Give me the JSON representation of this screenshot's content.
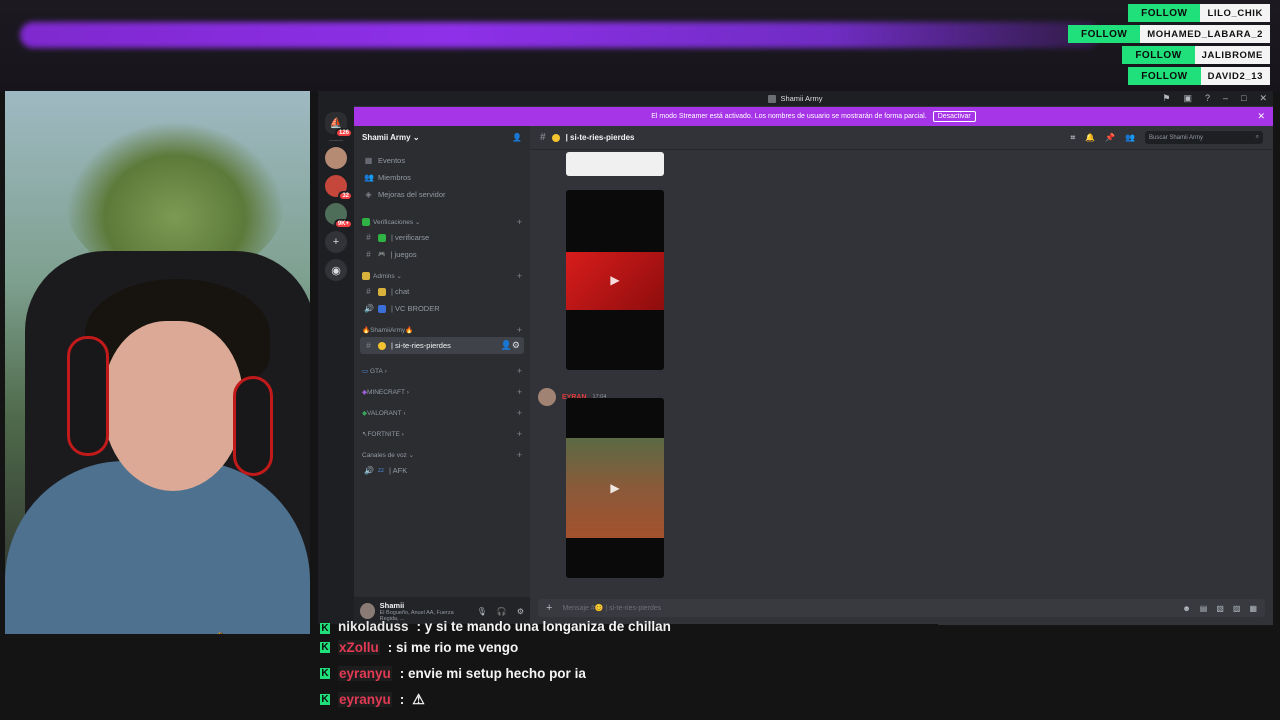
{
  "follows": [
    {
      "btn": "FOLLOW",
      "name": "LILO_CHIK"
    },
    {
      "btn": "FOLLOW",
      "name": "MOHAMED_LABARA_2"
    },
    {
      "btn": "FOLLOW",
      "name": "JALIBROME"
    },
    {
      "btn": "FOLLOW",
      "name": "DAVID2_13"
    }
  ],
  "discord": {
    "window_title": "Shamii Army",
    "streamer_notice": "El modo Streamer está activado. Los nombres de usuario se mostrarán de forma parcial.",
    "streamer_button": "Desactivar",
    "guild_badges": [
      "126",
      "32",
      "9K+"
    ],
    "server_name": "Shamii Army",
    "server_items": [
      {
        "icon": "calendar-icon",
        "label": "Eventos"
      },
      {
        "icon": "members-icon",
        "label": "Miembros"
      },
      {
        "icon": "boost-icon",
        "label": "Mejoras del servidor"
      }
    ],
    "categories": [
      {
        "label": "Verificaciones",
        "channels": [
          {
            "icon": "#",
            "label": "verificarse"
          },
          {
            "icon": "#",
            "label": "juegos"
          }
        ]
      },
      {
        "label": "Admins",
        "channels": [
          {
            "icon": "#",
            "label": "chat"
          },
          {
            "icon": "🔊",
            "label": "VC BRODER"
          }
        ]
      },
      {
        "label": "ShamiiArmy",
        "channels": [
          {
            "icon": "#",
            "label": "si-te-ries-pierdes",
            "active": true
          }
        ]
      },
      {
        "label": "GTA",
        "channels": []
      },
      {
        "label": "MINECRAFT",
        "channels": []
      },
      {
        "label": "VALORANT",
        "channels": []
      },
      {
        "label": "FORTNITE",
        "channels": []
      },
      {
        "label": "Canales de voz",
        "channels": [
          {
            "icon": "🔊",
            "label": "AFK"
          }
        ]
      }
    ],
    "user": {
      "name": "Shamii",
      "status": "El Bogueño, Anuel AA, Fuerza Regida, ..."
    },
    "channel_name": "si-te-ries-pierdes",
    "search_placeholder": "Buscar Shamii Army",
    "message": {
      "author": "EYRAN",
      "time": "17:04"
    },
    "composer_placeholder": "Mensaje #😊 | si-te-ries-pierdes"
  },
  "chat": [
    {
      "user": "nikoladuss",
      "user_color": "#e8e8e8",
      "text": ": y si te mando una longaniza de chillan"
    },
    {
      "user": "xZollu",
      "user_color": "#e23a54",
      "text": ": si me rio me vengo"
    },
    {
      "user": "eyranyu",
      "user_color": "#e23a54",
      "text": ": envie mi setup hecho por ia"
    },
    {
      "user": "eyranyu",
      "user_color": "#e23a54",
      "text": ":"
    }
  ]
}
